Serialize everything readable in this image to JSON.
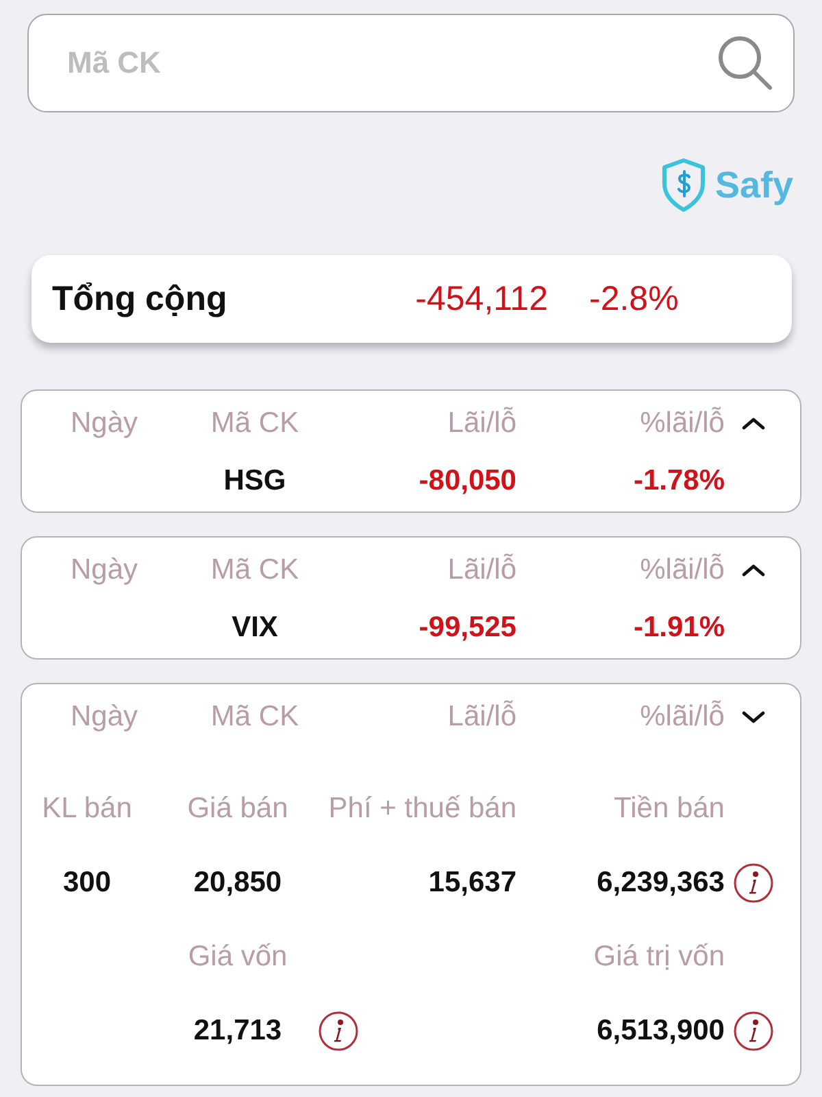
{
  "search": {
    "placeholder": "Mã CK"
  },
  "brand": {
    "name": "Safy"
  },
  "total": {
    "label": "Tổng cộng",
    "amount": "-454,112",
    "percent": "-2.8%"
  },
  "cards": [
    {
      "expanded": false,
      "headers": [
        "Ngày",
        "Mã CK",
        "Lãi/lỗ",
        "%lãi/lỗ"
      ],
      "row": {
        "symbol": "HSG",
        "profit": "-80,050",
        "percent": "-1.78%"
      }
    },
    {
      "expanded": false,
      "headers": [
        "Ngày",
        "Mã CK",
        "Lãi/lỗ",
        "%lãi/lỗ"
      ],
      "row": {
        "symbol": "VIX",
        "profit": "-99,525",
        "percent": "-1.91%"
      }
    },
    {
      "expanded": true,
      "headers": [
        "Ngày",
        "Mã CK",
        "Lãi/lỗ",
        "%lãi/lỗ"
      ],
      "details": [
        {
          "kind": "field",
          "label": "KL bán",
          "value": "300",
          "info": false
        },
        {
          "kind": "field",
          "label": "Giá bán",
          "value": "20,850",
          "info": false
        },
        {
          "kind": "field",
          "label": "Phí + thuế bán",
          "value": "15,637",
          "info": false
        },
        {
          "kind": "field",
          "label": "Tiền bán",
          "value": "6,239,363",
          "info": true
        },
        {
          "kind": "blank"
        },
        {
          "kind": "field",
          "label": "Giá vốn",
          "value": "21,713",
          "info": true
        },
        {
          "kind": "blank"
        },
        {
          "kind": "field",
          "label": "Giá trị vốn",
          "value": "6,513,900",
          "info": true
        }
      ]
    }
  ]
}
